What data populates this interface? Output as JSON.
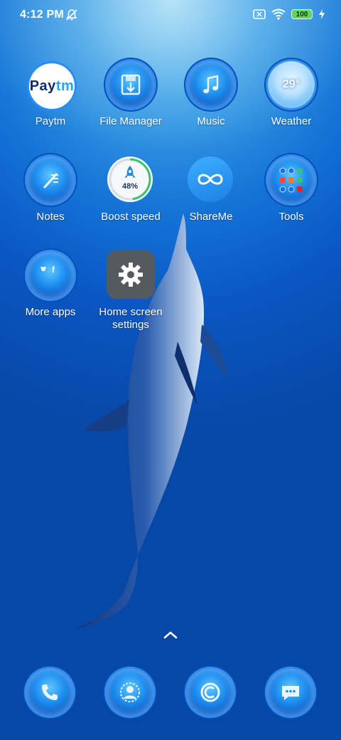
{
  "status_bar": {
    "time": "4:12 PM",
    "battery_level": "100",
    "icons": [
      "silent-bell-icon",
      "sim-blocked-icon",
      "wifi-icon",
      "battery-icon",
      "charging-bolt-icon"
    ]
  },
  "apps": {
    "paytm": {
      "label": "Paytm",
      "logo_left": "Pay",
      "logo_right": "tm",
      "icon": "paytm-logo"
    },
    "file_manager": {
      "label": "File Manager",
      "icon": "file-manager-icon"
    },
    "music": {
      "label": "Music",
      "icon": "music-note-icon"
    },
    "weather": {
      "label": "Weather",
      "temp": "29°",
      "icon": "weather-icon"
    },
    "notes": {
      "label": "Notes",
      "icon": "notes-icon"
    },
    "boost_speed": {
      "label": "Boost speed",
      "percent": "48%",
      "icon": "rocket-icon"
    },
    "shareme": {
      "label": "ShareMe",
      "icon": "infinity-icon"
    },
    "tools": {
      "label": "Tools",
      "icon": "tools-folder-icon"
    },
    "more_apps": {
      "label": "More apps",
      "icon": "more-apps-folder-icon"
    },
    "home_settings": {
      "label": "Home screen settings",
      "icon": "gear-icon"
    }
  },
  "dock": [
    {
      "name": "phone",
      "icon": "phone-icon"
    },
    {
      "name": "contacts",
      "icon": "contacts-icon"
    },
    {
      "name": "browser",
      "icon": "browser-icon"
    },
    {
      "name": "messages",
      "icon": "messages-icon"
    }
  ],
  "colors": {
    "wallpaper_top": "#8fd3f4",
    "wallpaper_bottom": "#0747a6",
    "icon_ring": "#2f8ff5",
    "battery_green": "#5bd85a",
    "settings_tile": "#555a5e"
  }
}
